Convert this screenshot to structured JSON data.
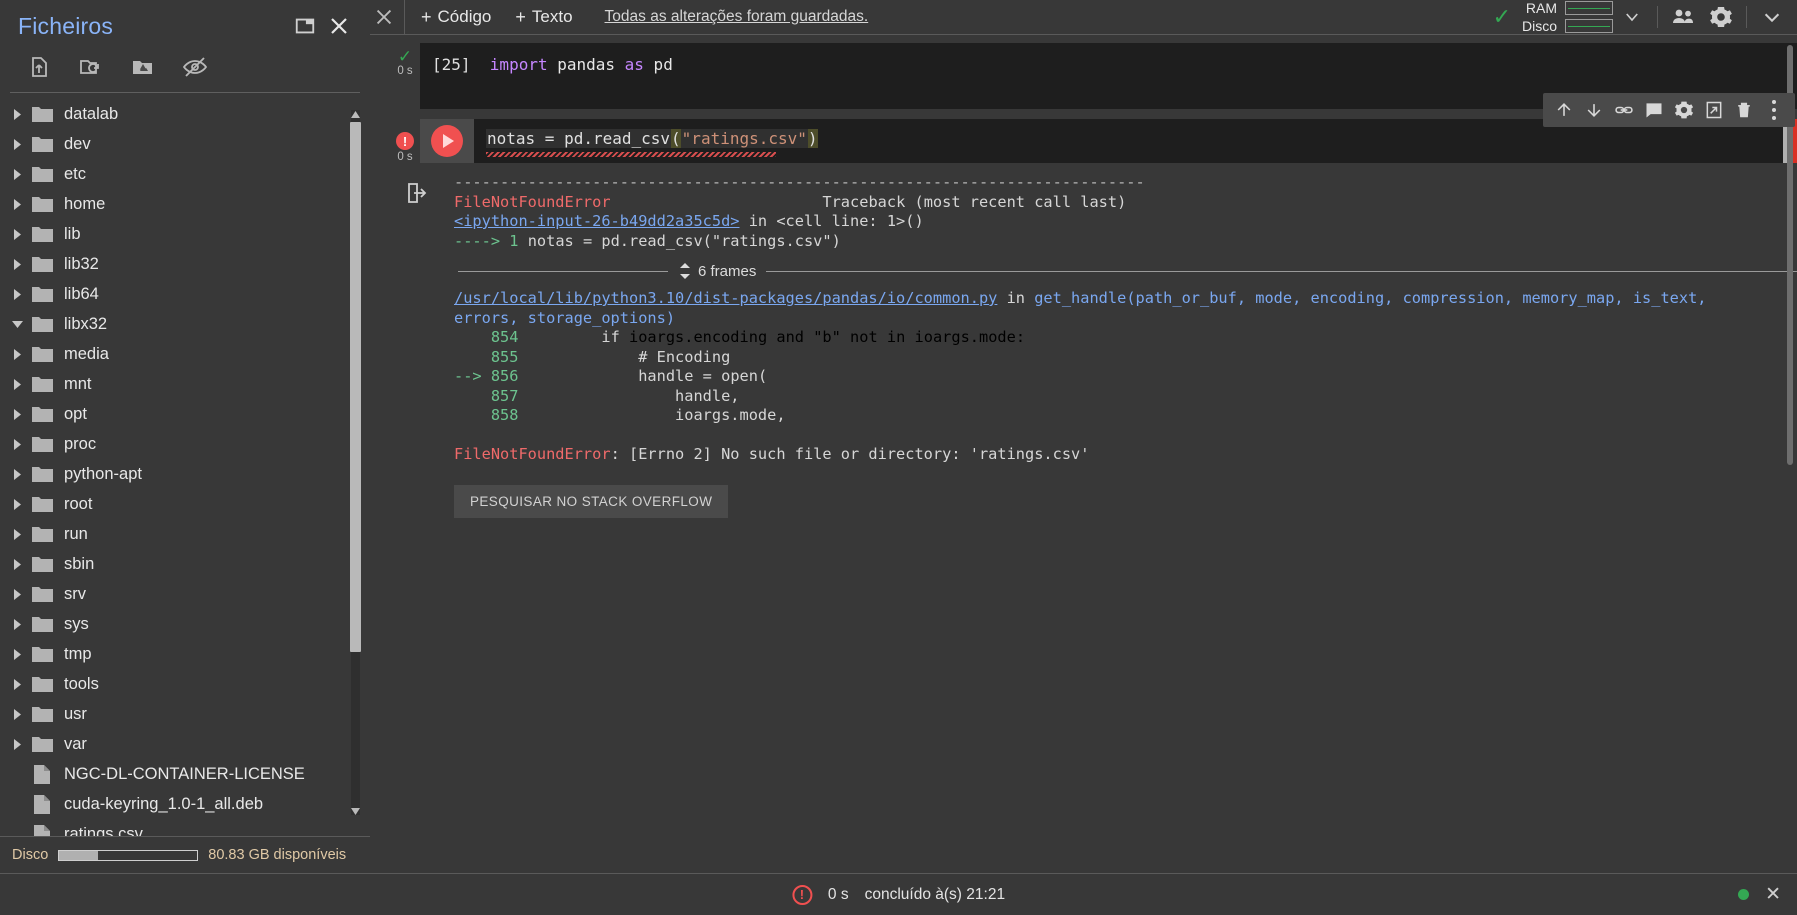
{
  "sidebar": {
    "title": "Ficheiros",
    "header_button": "open-in-new-icon",
    "toolbar": [
      {
        "name": "upload-file-icon",
        "label": "Carregar para o armazenamento da sessão"
      },
      {
        "name": "new-folder-icon",
        "label": "Atualizar"
      },
      {
        "name": "mount-drive-icon",
        "label": "Ativar o Drive"
      },
      {
        "name": "toggle-hidden-icon",
        "label": "Mostrar ficheiros ocultos"
      }
    ],
    "tree": [
      {
        "label": "datalab",
        "type": "folder",
        "expanded": false
      },
      {
        "label": "dev",
        "type": "folder",
        "expanded": false
      },
      {
        "label": "etc",
        "type": "folder",
        "expanded": false
      },
      {
        "label": "home",
        "type": "folder",
        "expanded": false
      },
      {
        "label": "lib",
        "type": "folder",
        "expanded": false
      },
      {
        "label": "lib32",
        "type": "folder",
        "expanded": false
      },
      {
        "label": "lib64",
        "type": "folder",
        "expanded": false
      },
      {
        "label": "libx32",
        "type": "folder",
        "expanded": true
      },
      {
        "label": "media",
        "type": "folder",
        "expanded": false
      },
      {
        "label": "mnt",
        "type": "folder",
        "expanded": false
      },
      {
        "label": "opt",
        "type": "folder",
        "expanded": false
      },
      {
        "label": "proc",
        "type": "folder",
        "expanded": false
      },
      {
        "label": "python-apt",
        "type": "folder",
        "expanded": false
      },
      {
        "label": "root",
        "type": "folder",
        "expanded": false
      },
      {
        "label": "run",
        "type": "folder",
        "expanded": false
      },
      {
        "label": "sbin",
        "type": "folder",
        "expanded": false
      },
      {
        "label": "srv",
        "type": "folder",
        "expanded": false
      },
      {
        "label": "sys",
        "type": "folder",
        "expanded": false
      },
      {
        "label": "tmp",
        "type": "folder",
        "expanded": false
      },
      {
        "label": "tools",
        "type": "folder",
        "expanded": false
      },
      {
        "label": "usr",
        "type": "folder",
        "expanded": false
      },
      {
        "label": "var",
        "type": "folder",
        "expanded": false
      },
      {
        "label": "NGC-DL-CONTAINER-LICENSE",
        "type": "file",
        "expanded": false
      },
      {
        "label": "cuda-keyring_1.0-1_all.deb",
        "type": "file",
        "expanded": false
      },
      {
        "label": "ratings.csv",
        "type": "file",
        "expanded": false
      }
    ],
    "disk": {
      "label": "Disco",
      "available": "80.83 GB disponíveis",
      "used_percent": 28
    }
  },
  "topbar": {
    "close_icon": "close-icon",
    "add_code": "Código",
    "add_text": "Texto",
    "saved_message": "Todas as alterações foram guardadas.",
    "resources": {
      "ram_label": "RAM",
      "disk_label": "Disco",
      "status_icon": "check-icon",
      "dropdown_icon": "chevron-down-icon"
    },
    "share_icon": "people-icon",
    "settings_icon": "gear-icon",
    "expand_icon": "chevron-down-icon"
  },
  "cells": [
    {
      "execution_count": "[25]",
      "runtime": "0 s",
      "status": "ok",
      "code_tokens": [
        {
          "t": "import",
          "c": "kw"
        },
        {
          "t": " pandas ",
          "c": "id"
        },
        {
          "t": "as",
          "c": "kw"
        },
        {
          "t": " pd",
          "c": "id"
        }
      ],
      "code_plain": "import pandas as pd"
    },
    {
      "execution_count": "",
      "runtime": "0 s",
      "status": "error",
      "code_plain": "notas = pd.read_csv(\"ratings.csv\")",
      "code_prefix": "notas = pd.read_csv",
      "code_open_paren": "(",
      "code_string": "\"ratings.csv\"",
      "code_close_paren": ")"
    }
  ],
  "cell_toolbar": [
    {
      "name": "move-cell-up-icon"
    },
    {
      "name": "move-cell-down-icon"
    },
    {
      "name": "link-to-cell-icon"
    },
    {
      "name": "add-comment-icon"
    },
    {
      "name": "cell-settings-icon"
    },
    {
      "name": "mirror-cell-icon"
    },
    {
      "name": "delete-cell-icon"
    },
    {
      "name": "more-options-icon"
    }
  ],
  "output": {
    "separator": "---------------------------------------------------------------------------",
    "error_name": "FileNotFoundError",
    "traceback_header": "Traceback (most recent call last)",
    "input_ref": "<ipython-input-26-b49dd2a35c5d>",
    "input_ref_suffix": " in <cell line: 1>()",
    "arrow_line_marker": "----> 1 ",
    "arrow_line_code": "notas = pd.read_csv(\"ratings.csv\")",
    "frames_label": "6 frames",
    "file_path": "/usr/local/lib/python3.10/dist-packages/pandas/io/common.py",
    "file_sig_in": " in ",
    "file_sig_fn": "get_handle(path_or_buf, mode, encoding, compression, memory_map, is_text,",
    "file_sig_cont": "errors, storage_options)",
    "source_lines": [
      {
        "marker": "",
        "num": "854",
        "code": "    if ioargs.encoding and \"b\" not in ioargs.mode:"
      },
      {
        "marker": "",
        "num": "855",
        "code": "        # Encoding"
      },
      {
        "marker": "--> ",
        "num": "856",
        "code": "        handle = open("
      },
      {
        "marker": "",
        "num": "857",
        "code": "            handle,"
      },
      {
        "marker": "",
        "num": "858",
        "code": "            ioargs.mode,"
      }
    ],
    "final_error_name": "FileNotFoundError",
    "final_error_msg": ": [Errno 2] No such file or directory: 'ratings.csv'",
    "stack_overflow_button": "PESQUISAR NO STACK OVERFLOW"
  },
  "statusbar": {
    "error_icon": "error-circle-icon",
    "elapsed": "0 s",
    "message": "concluído à(s) 21:21",
    "connected_icon": "connected-dot",
    "close_icon": "close-icon"
  },
  "colors": {
    "accent_blue": "#8ab4f8",
    "error_red": "#f05050",
    "success_green": "#34a853",
    "panel_bg": "#383838",
    "code_bg": "#1e1e1e"
  }
}
